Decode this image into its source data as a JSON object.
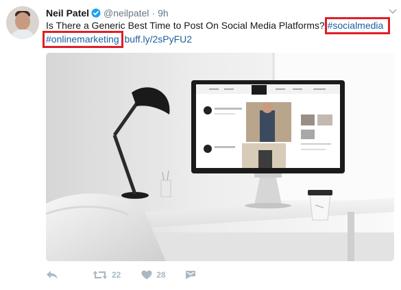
{
  "tweet": {
    "author": {
      "name": "Neil Patel",
      "handle": "@neilpatel",
      "time": "9h",
      "separator": "·"
    },
    "text_line1": "Is There a Generic Best Time to Post On Social Media Platforms? ",
    "hashtag1": "#socialmedia",
    "hashtag2": "#onlinemarketing",
    "link": "buff.ly/2sPyFU2",
    "image_alt": "Desk with lamp and computer monitor",
    "actions": {
      "retweet_count": "22",
      "like_count": "28"
    },
    "colors": {
      "text": "#14171a",
      "muted": "#657786",
      "link": "#1b5e9c",
      "highlight": "#e11d25",
      "action": "#aab8c2",
      "verified": "#1da1f2"
    },
    "icons": [
      "verified-badge-icon",
      "caret-down-icon",
      "reply-icon",
      "retweet-icon",
      "like-icon",
      "direct-message-icon"
    ]
  }
}
